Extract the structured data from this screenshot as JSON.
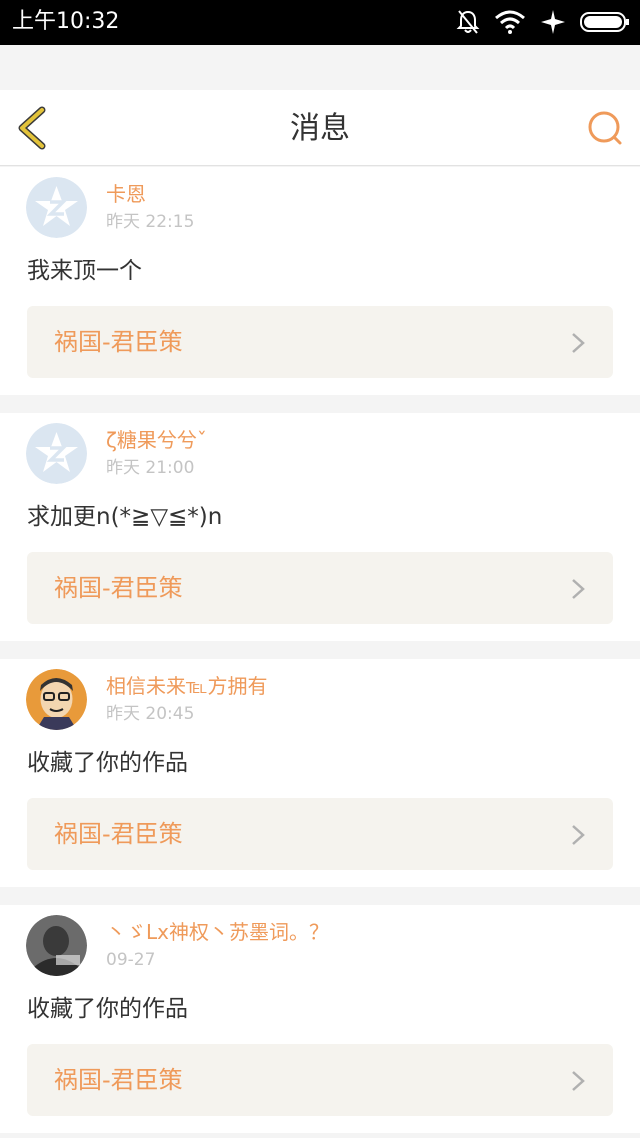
{
  "status_bar": {
    "time": "上午10:32",
    "icons": [
      "bell-off-icon",
      "wifi-icon",
      "airplane-icon",
      "battery-icon"
    ]
  },
  "header": {
    "title": "消息",
    "back_icon": "chevron-left-icon",
    "search_icon": "search-icon"
  },
  "colors": {
    "accent": "#ef9a5a",
    "back_arrow": "#e3c33a",
    "card_link_bg": "#f5f3ee",
    "text": "#333333",
    "muted": "#c4c4c4"
  },
  "messages": [
    {
      "username": "卡恩",
      "time": "昨天 22:15",
      "content": "我来顶一个",
      "work_title": "祸国-君臣策",
      "avatar": "qzone-default-avatar"
    },
    {
      "username": "ζ糖果兮兮ˇ",
      "time": "昨天 21:00",
      "content": "求加更n(*≧▽≦*)n",
      "work_title": "祸国-君臣策",
      "avatar": "qzone-default-avatar"
    },
    {
      "username": "相信未来℡方拥有",
      "time": "昨天 20:45",
      "content": "收藏了你的作品",
      "work_title": "祸国-君臣策",
      "avatar": "cartoon-man-avatar"
    },
    {
      "username": "丶ゞLx神权丶苏墨词。？",
      "time": "09-27",
      "content": "收藏了你的作品",
      "work_title": "祸国-君臣策",
      "avatar": "photo-avatar"
    }
  ]
}
